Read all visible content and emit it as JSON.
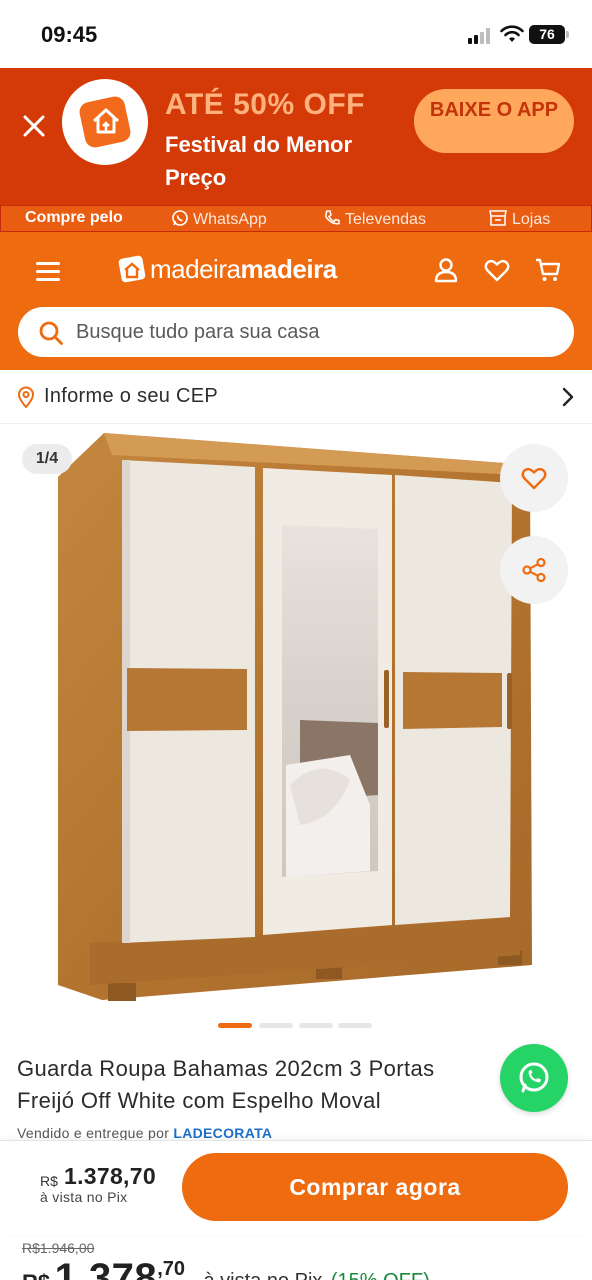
{
  "status_bar": {
    "time": "09:45",
    "battery": "76"
  },
  "promo": {
    "headline": "ATÉ 50% OFF",
    "subtitle": "Festival do Menor Preço",
    "cta": "BAIXE O APP"
  },
  "contact": {
    "lead": "Compre pelo",
    "whatsapp": "WhatsApp",
    "televendas": "Televendas",
    "lojas": "Lojas"
  },
  "header": {
    "brand_light": "madeira",
    "brand_bold": "madeira",
    "search_placeholder": "Busque tudo para sua casa"
  },
  "cep": {
    "label": "Informe o seu CEP"
  },
  "gallery": {
    "counter": "1/4",
    "total_images": 4,
    "active_index": 0
  },
  "product": {
    "title": "Guarda Roupa Bahamas 202cm 3 Portas Freijó Off White com Espelho Moval",
    "seller_prefix": "Vendido e entregue por",
    "seller_name": "LADECORATA"
  },
  "buy_bar": {
    "currency": "R$",
    "price": "1.378,70",
    "note": "à vista no Pix",
    "button": "Comprar agora"
  },
  "pricing": {
    "old_price": "R$1.946,00",
    "currency": "R$",
    "integer": "1.378",
    "decimals": ",70",
    "pix_label": "à vista no Pix",
    "discount": "(15% OFF)"
  },
  "colors": {
    "brand_orange": "#ee6b10",
    "promo_red": "#d33a07",
    "whatsapp_green": "#25d366"
  }
}
